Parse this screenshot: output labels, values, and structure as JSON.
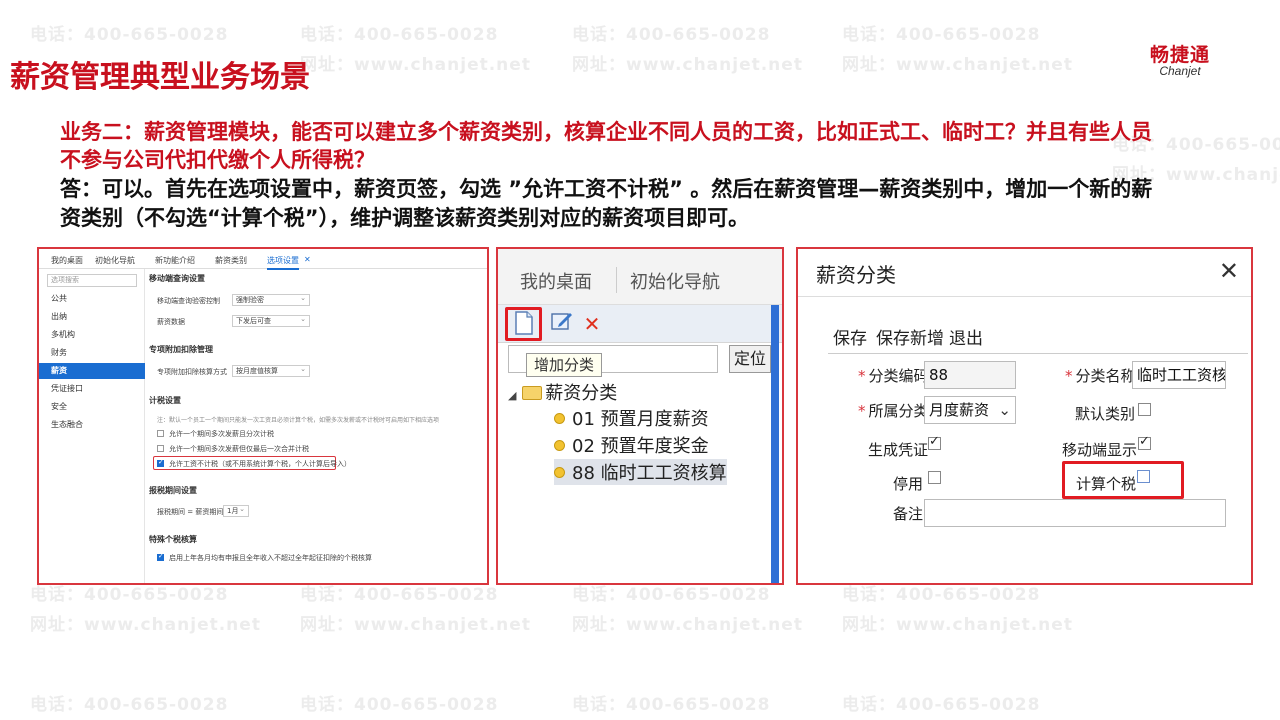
{
  "page": {
    "title": "薪资管理典型业务场景",
    "logo_cn": "畅捷通",
    "logo_en": "Chanjet",
    "watermark_phone": "电话：400-665-0028",
    "watermark_web": "网址：www.chanjet.net"
  },
  "qa": {
    "question": "业务二：薪资管理模块，能否可以建立多个薪资类别，核算企业不同人员的工资，比如正式工、临时工？并且有些人员不参与公司代扣代缴个人所得税？",
    "answer": "答：可以。首先在选项设置中，薪资页签，勾选 ”允许工资不计税” 。然后在薪资管理—薪资类别中，增加一个新的薪资类别（不勾选“计算个税”），维护调整该薪资类别对应的薪资项目即可。"
  },
  "options_panel": {
    "tabs": [
      "我的桌面",
      "初始化导航",
      "新功能介绍",
      "薪资类别",
      "选项设置"
    ],
    "search_placeholder": "选项搜索",
    "side_items": [
      "公共",
      "出纳",
      "多机构",
      "财务",
      "薪资",
      "凭证接口",
      "安全",
      "生态融合"
    ],
    "sections": {
      "mobile": "移动端查询设置",
      "mobile_pwd_label": "移动端查询验密控制",
      "mobile_pwd_value": "强制验密",
      "salary_data_label": "薪资数据",
      "salary_data_value": "下发后可查",
      "special": "专项附加扣除管理",
      "special_label": "专项附加扣除核算方式",
      "special_value": "按月度值核算",
      "tax": "计税设置",
      "tax_note": "注：默认一个员工一个期间只能发一次工资且必须计算个税，如需多次发薪或不计税时可启用如下相应选项",
      "tax_opt1": "允许一个期间多次发薪且分次计税",
      "tax_opt2": "允许一个期间多次发薪但仅最后一次合并计税",
      "tax_opt3": "允许工资不计税（或不用系统计算个税，个人计算后导入）",
      "period": "报税期间设置",
      "period_label": "报税期间 = 薪资期间 +",
      "period_value": "1月",
      "special_tax": "特殊个税核算",
      "special_tax_opt": "启用上年各月均有申报且全年收入不超过全年起征扣除的个税核算"
    }
  },
  "category_panel": {
    "top_tabs": [
      "我的桌面",
      "初始化导航"
    ],
    "tooltip": "增加分类",
    "locate_button": "定位",
    "root": "薪资分类",
    "items": [
      "01 预置月度薪资",
      "02 预置年度奖金",
      "88 临时工工资核算"
    ]
  },
  "dialog": {
    "title": "薪资分类",
    "menu": [
      "保存",
      "保存新增",
      "退出"
    ],
    "code_label": "分类编码",
    "code_value": "88",
    "name_label": "分类名称",
    "name_value": "临时工工资核...",
    "parent_label": "所属分类",
    "parent_value": "月度薪资",
    "default_label": "默认类别",
    "voucher_label": "生成凭证",
    "mobile_label": "移动端显示",
    "disable_label": "停用",
    "tax_label": "计算个税",
    "remark_label": "备注"
  }
}
